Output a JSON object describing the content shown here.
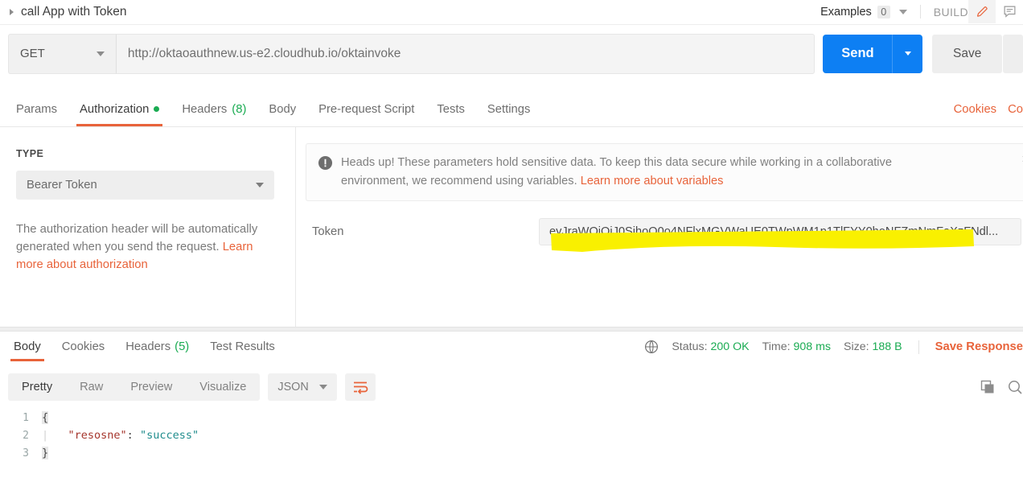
{
  "header": {
    "request_title": "call App with Token",
    "disclosure_icon": "triangle-right-icon",
    "examples_label": "Examples",
    "examples_count": "0",
    "build_label": "BUILD",
    "edit_icon": "pencil-icon",
    "comment_icon": "comment-icon"
  },
  "request": {
    "method": "GET",
    "url": "http://oktaoauthnew.us-e2.cloudhub.io/oktainvoke",
    "send_label": "Send",
    "send_caret_icon": "chevron-down-icon",
    "save_label": "Save",
    "accent_blue": "#0d7ff3"
  },
  "request_tabs": [
    {
      "label": "Params",
      "active": false,
      "dot": false,
      "count": ""
    },
    {
      "label": "Authorization",
      "active": true,
      "dot": true,
      "count": ""
    },
    {
      "label": "Headers",
      "active": false,
      "dot": false,
      "count": "(8)"
    },
    {
      "label": "Body",
      "active": false,
      "dot": false,
      "count": ""
    },
    {
      "label": "Pre-request Script",
      "active": false,
      "dot": false,
      "count": ""
    },
    {
      "label": "Tests",
      "active": false,
      "dot": false,
      "count": ""
    },
    {
      "label": "Settings",
      "active": false,
      "dot": false,
      "count": ""
    }
  ],
  "request_tabs_right": {
    "cookies_label": "Cookies",
    "code_label": "Co",
    "accent_orange": "#e8633a"
  },
  "authorization": {
    "type_label": "TYPE",
    "type_value": "Bearer Token",
    "type_caret_icon": "chevron-down-icon",
    "description": "The authorization header will be automatically generated when you send the request.",
    "description_link": "Learn more about authorization",
    "banner": {
      "icon": "warning-exclamation-icon",
      "text": "Heads up! These parameters hold sensitive data. To keep this data secure while working in a collaborative environment, we recommend using variables.",
      "link": "Learn more about variables",
      "close_icon": "close-icon",
      "close_glyph": "×"
    },
    "token_label": "Token",
    "token_value": "eyJraWQiOiJ0SjhoQ0o4NFlxMGVWaUE0TWpWM1p1TlFYY0hoNFZmNmFaXzFNdl...",
    "highlight_color": "#f9f000"
  },
  "response_tabs": [
    {
      "label": "Body",
      "active": true,
      "count": ""
    },
    {
      "label": "Cookies",
      "active": false,
      "count": ""
    },
    {
      "label": "Headers",
      "active": false,
      "count": "(5)"
    },
    {
      "label": "Test Results",
      "active": false,
      "count": ""
    }
  ],
  "response_meta": {
    "globe_icon": "globe-icon",
    "status_label": "Status:",
    "status_value": "200 OK",
    "time_label": "Time:",
    "time_value": "908 ms",
    "size_label": "Size:",
    "size_value": "188 B",
    "save_response_label": "Save Response",
    "success_green": "#1aab52"
  },
  "response_toolbar": {
    "views": [
      {
        "label": "Pretty",
        "active": true
      },
      {
        "label": "Raw",
        "active": false
      },
      {
        "label": "Preview",
        "active": false
      },
      {
        "label": "Visualize",
        "active": false
      }
    ],
    "format_value": "JSON",
    "format_caret_icon": "chevron-down-icon",
    "wrap_icon": "word-wrap-icon",
    "copy_icon": "copy-icon",
    "search_icon": "search-icon"
  },
  "response_body": {
    "lines": [
      {
        "number": "1",
        "kind": "open-brace",
        "text": "{"
      },
      {
        "number": "2",
        "kind": "pair",
        "key": "\"resosne\"",
        "colon": ": ",
        "value": "\"success\""
      },
      {
        "number": "3",
        "kind": "close-brace",
        "text": "}"
      }
    ]
  }
}
